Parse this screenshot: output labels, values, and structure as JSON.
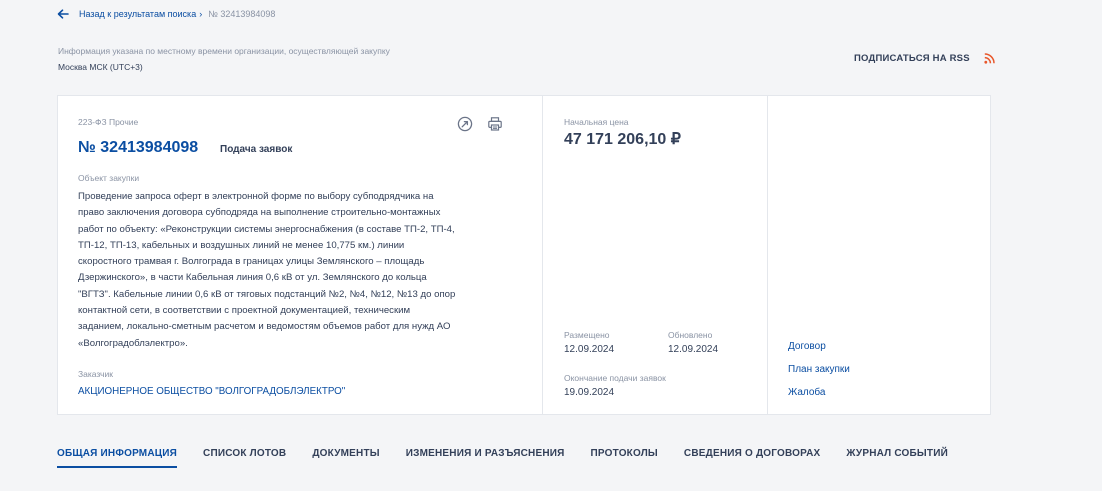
{
  "breadcrumb": {
    "back_label": "Назад к результатам поиска",
    "separator": "›",
    "current": "№ 32413984098"
  },
  "timezone": {
    "note": "Информация указана по местному времени организации, осуществляющей закупку",
    "value": "Москва МСК (UTC+3)"
  },
  "rss": {
    "label": "ПОДПИСАТЬСЯ НА RSS",
    "icon": "rss-icon",
    "color": "#e8572b"
  },
  "card": {
    "law_type": "223-ФЗ Прочие",
    "number": "№ 32413984098",
    "status": "Подача заявок",
    "icons": [
      "history-icon",
      "print-icon"
    ],
    "object_label": "Объект закупки",
    "object_lines": [
      "Проведение запроса оферт в электронной форме по выбору субподрядчика на",
      "право заключения договора субподряда на выполнение строительно-монтажных",
      "работ по объекту: «Реконструкции системы энергоснабжения (в составе ТП-2, ТП-4,",
      "ТП-12, ТП-13, кабельных и воздушных линий не менее 10,775 км.) линии",
      "скоростного трамвая г. Волгограда в границах улицы Землянского – площадь",
      "Дзержинского», в части Кабельная линия 0,6 кВ от ул. Землянского до кольца",
      "\"ВГТЗ\". Кабельные линии 0,6 кВ от тяговых подстанций №2, №4, №12, №13 до опор",
      "контактной сети, в соответствии с проектной документацией, техническим",
      "заданием, локально-сметным расчетом и ведомостям объемов работ для нужд АО",
      "«Волгоградоблэлектро»."
    ],
    "customer_label": "Заказчик",
    "customer_name": "АКЦИОНЕРНОЕ ОБЩЕСТВО \"ВОЛГОГРАДОБЛЭЛЕКТРО\""
  },
  "price": {
    "label": "Начальная цена",
    "value": "47 171 206,10 ₽"
  },
  "dates": {
    "posted_label": "Размещено",
    "posted_value": "12.09.2024",
    "updated_label": "Обновлено",
    "updated_value": "12.09.2024",
    "deadline_label": "Окончание подачи заявок",
    "deadline_value": "19.09.2024"
  },
  "links": [
    "Договор",
    "План закупки",
    "Жалоба"
  ],
  "tabs": [
    {
      "label": "ОБЩАЯ ИНФОРМАЦИЯ",
      "active": true
    },
    {
      "label": "СПИСОК ЛОТОВ"
    },
    {
      "label": "ДОКУМЕНТЫ"
    },
    {
      "label": "ИЗМЕНЕНИЯ И РАЗЪЯСНЕНИЯ"
    },
    {
      "label": "ПРОТОКОЛЫ"
    },
    {
      "label": "СВЕДЕНИЯ О ДОГОВОРАХ"
    },
    {
      "label": "ЖУРНАЛ СОБЫТИЙ"
    }
  ],
  "colors": {
    "accent": "#0b4ea2",
    "text": "#334059",
    "muted": "#8a93a4"
  }
}
